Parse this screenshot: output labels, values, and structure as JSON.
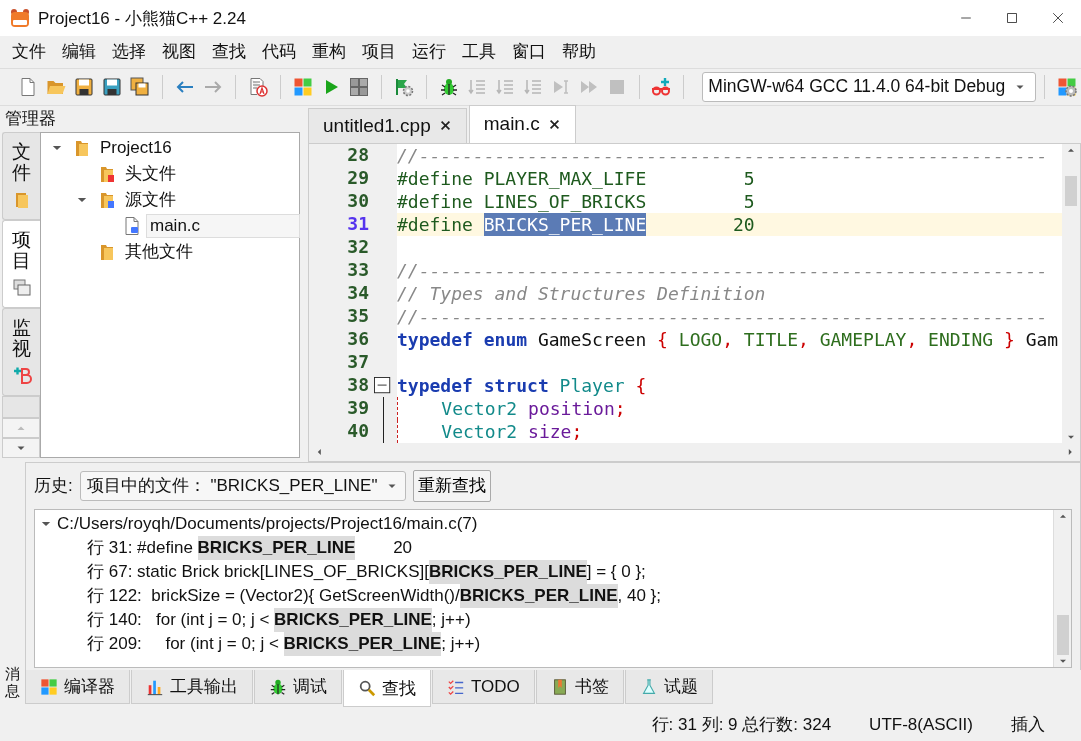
{
  "window": {
    "title": "Project16 - 小熊猫C++ 2.24"
  },
  "menu": [
    "文件",
    "编辑",
    "选择",
    "视图",
    "查找",
    "代码",
    "重构",
    "项目",
    "运行",
    "工具",
    "窗口",
    "帮助"
  ],
  "toolbar": {
    "groups": [
      [
        {
          "kind": "new",
          "disabled": false
        },
        {
          "kind": "open",
          "disabled": false
        },
        {
          "kind": "save",
          "disabled": false
        },
        {
          "kind": "save-as",
          "disabled": false
        },
        {
          "kind": "save-all",
          "disabled": false
        }
      ],
      [
        {
          "kind": "back",
          "disabled": false
        },
        {
          "kind": "forward",
          "disabled": true
        }
      ],
      [
        {
          "kind": "format",
          "disabled": false
        }
      ],
      [
        {
          "kind": "compile",
          "disabled": false
        },
        {
          "kind": "run",
          "disabled": false
        },
        {
          "kind": "rebuild",
          "disabled": false
        }
      ],
      [
        {
          "kind": "run-params",
          "disabled": false
        }
      ],
      [
        {
          "kind": "debug",
          "disabled": false
        },
        {
          "kind": "step-over",
          "disabled": true
        },
        {
          "kind": "step-into",
          "disabled": true
        },
        {
          "kind": "step-out",
          "disabled": true
        },
        {
          "kind": "run-to-cursor",
          "disabled": true
        },
        {
          "kind": "continue",
          "disabled": true
        },
        {
          "kind": "stop",
          "disabled": true
        }
      ],
      [
        {
          "kind": "add-watch",
          "disabled": false
        }
      ]
    ],
    "compiler": "MinGW-w64 GCC 11.4.0 64-bit Debug",
    "after": [
      {
        "kind": "options",
        "disabled": false
      }
    ]
  },
  "manager": {
    "title": "管理器",
    "side_tabs": [
      {
        "label": "文件",
        "kind": "folder",
        "selected": false
      },
      {
        "label": "项目",
        "kind": "windows",
        "selected": true
      },
      {
        "label": "监视",
        "kind": "watch",
        "selected": false
      }
    ],
    "tree": [
      {
        "label": "Project16",
        "kind": "folder",
        "selected": false,
        "expanded": true,
        "children": [
          {
            "label": "头文件",
            "kind": "header-folder",
            "selected": false
          },
          {
            "label": "源文件",
            "kind": "source-folder",
            "selected": false,
            "expanded": true,
            "children": [
              {
                "label": "main.c",
                "kind": "c-file",
                "selected": true
              }
            ]
          },
          {
            "label": "其他文件",
            "kind": "folder",
            "selected": false
          }
        ]
      }
    ]
  },
  "editor": {
    "tabs": [
      {
        "label": "untitled1.cpp",
        "selected": false
      },
      {
        "label": "main.c",
        "selected": true
      }
    ],
    "lines": [
      {
        "number": "28",
        "current": false,
        "tokens": [
          {
            "kind": "comment",
            "text": "//----------------------------------------------------------"
          }
        ]
      },
      {
        "number": "29",
        "current": false,
        "tokens": [
          {
            "kind": "preproc",
            "text": "#define PLAYER_MAX_LIFE         5"
          }
        ]
      },
      {
        "number": "30",
        "current": false,
        "tokens": [
          {
            "kind": "preproc",
            "text": "#define LINES_OF_BRICKS         5"
          }
        ]
      },
      {
        "number": "31",
        "current": true,
        "tokens": [
          {
            "kind": "preproc",
            "text": "#define "
          },
          {
            "kind": "selected",
            "text": "BRICKS_PER_LINE"
          },
          {
            "kind": "preproc",
            "text": "        20"
          }
        ]
      },
      {
        "number": "32",
        "current": false
      },
      {
        "number": "33",
        "current": false,
        "tokens": [
          {
            "kind": "comment",
            "text": "//----------------------------------------------------------"
          }
        ]
      },
      {
        "number": "34",
        "current": false,
        "tokens": [
          {
            "kind": "comment",
            "text": "// Types and Structures Definition"
          }
        ]
      },
      {
        "number": "35",
        "current": false,
        "tokens": [
          {
            "kind": "comment",
            "text": "//----------------------------------------------------------"
          }
        ]
      },
      {
        "number": "36",
        "current": false,
        "tokens": [
          {
            "kind": "keyword",
            "text": "typedef "
          },
          {
            "kind": "keyword",
            "text": "enum "
          },
          {
            "kind": "plain",
            "text": "GameScreen "
          },
          {
            "kind": "punct",
            "text": "{"
          },
          {
            "kind": "enumval",
            "text": " LOGO"
          },
          {
            "kind": "punct",
            "text": ","
          },
          {
            "kind": "enumval",
            "text": " TITLE"
          },
          {
            "kind": "punct",
            "text": ","
          },
          {
            "kind": "enumval",
            "text": " GAMEPLAY"
          },
          {
            "kind": "punct",
            "text": ","
          },
          {
            "kind": "enumval",
            "text": " ENDING "
          },
          {
            "kind": "punct",
            "text": "}"
          },
          {
            "kind": "plain",
            "text": " Gam"
          }
        ]
      },
      {
        "number": "37",
        "current": false
      },
      {
        "number": "38",
        "current": false,
        "fold_start": true,
        "tokens": [
          {
            "kind": "keyword",
            "text": "typedef "
          },
          {
            "kind": "keyword",
            "text": "struct "
          },
          {
            "kind": "type",
            "text": "Player "
          },
          {
            "kind": "punct",
            "text": "{"
          }
        ]
      },
      {
        "number": "39",
        "current": false,
        "in_fold": true,
        "tokens": [
          {
            "kind": "type",
            "text": "    Vector2 "
          },
          {
            "kind": "member",
            "text": "position"
          },
          {
            "kind": "punct",
            "text": ";"
          }
        ]
      },
      {
        "number": "40",
        "current": false,
        "in_fold": true,
        "tokens": [
          {
            "kind": "type",
            "text": "    Vector2 "
          },
          {
            "kind": "member",
            "text": "size"
          },
          {
            "kind": "punct",
            "text": ";"
          }
        ]
      }
    ]
  },
  "find": {
    "history_label": "历史:",
    "query": "项目中的文件：  \"BRICKS_PER_LINE\"",
    "research_button": "重新查找",
    "results": [
      {
        "file": "C:/Users/royqh/Documents/projects/Project16/main.c(7)",
        "expanded": true,
        "matches": [
          "行 31: #define **BRICKS_PER_LINE**        20",
          "行 67: static Brick brick[LINES_OF_BRICKS][**BRICKS_PER_LINE**] = { 0 };",
          "行 122:  brickSize = (Vector2){ GetScreenWidth()/**BRICKS_PER_LINE**, 40 };",
          "行 140:   for (int j = 0; j < **BRICKS_PER_LINE**; j++)",
          "行 209:     for (int j = 0; j < **BRICKS_PER_LINE**; j++)"
        ]
      }
    ]
  },
  "messages_label": "消息",
  "bottom_tabs": [
    {
      "label": "编译器",
      "kind": "compiler",
      "selected": false
    },
    {
      "label": "工具输出",
      "kind": "tools",
      "selected": false
    },
    {
      "label": "调试",
      "kind": "debug",
      "selected": false
    },
    {
      "label": "查找",
      "kind": "find",
      "selected": true
    },
    {
      "label": "TODO",
      "kind": "todo",
      "selected": false
    },
    {
      "label": "书签",
      "kind": "bookmarks",
      "selected": false
    },
    {
      "label": "试题",
      "kind": "problems",
      "selected": false
    }
  ],
  "status_bar": [
    "行: 31 列: 9 总行数: 324",
    "UTF-8(ASCII)",
    "插入"
  ]
}
